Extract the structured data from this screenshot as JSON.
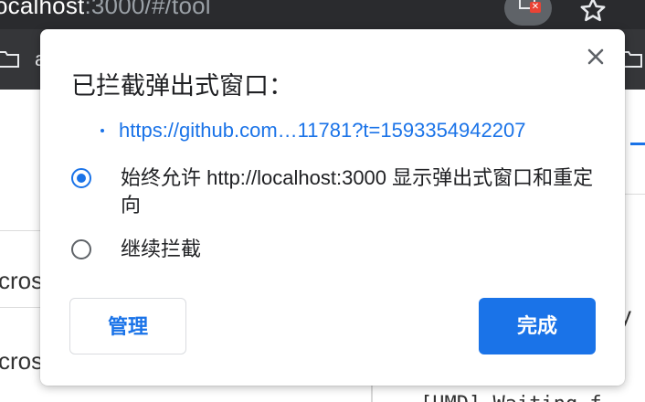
{
  "browser": {
    "url_host": "ocalhost",
    "url_rest": ":3000/#/tool",
    "bookmark_fragment": "a"
  },
  "background_page": {
    "left_fragments": [
      "cros",
      "cros"
    ],
    "right_fragment_1": "y",
    "right_fragment_2": "[UMD] Waiting f"
  },
  "dialog": {
    "title": "已拦截弹出式窗口：",
    "blocked_popup_link": "https://github.com…11781?t=1593354942207",
    "options": [
      {
        "label": "始终允许 http://localhost:3000 显示弹出式窗口和重定向",
        "selected": true
      },
      {
        "label": "继续拦截",
        "selected": false
      }
    ],
    "manage_button": "管理",
    "done_button": "完成"
  },
  "colors": {
    "accent": "#1a73e8",
    "chrome_dark": "#2a2b2e"
  }
}
